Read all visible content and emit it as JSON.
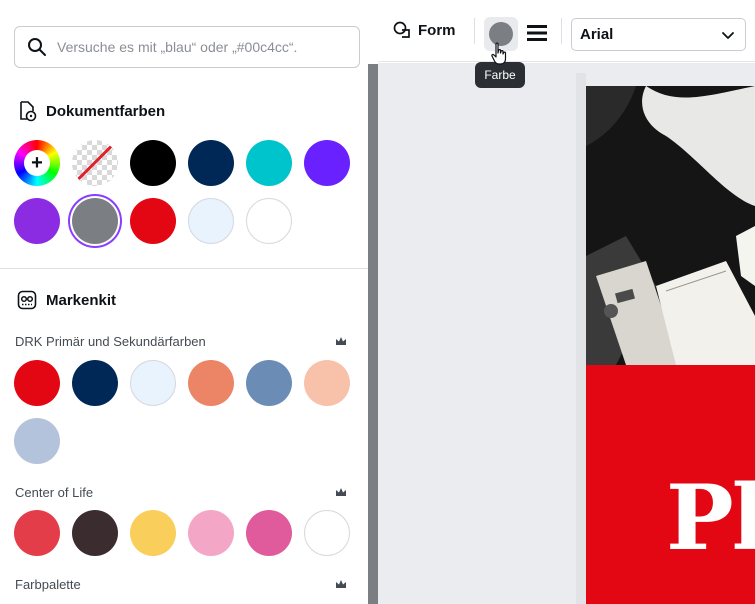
{
  "search": {
    "placeholder": "Versuche es mit „blau“ oder „#00c4cc“."
  },
  "document_colors": {
    "title": "Dokumentfarben",
    "swatches": [
      {
        "kind": "add",
        "color": "rainbow"
      },
      {
        "kind": "transparent",
        "color": "transparent"
      },
      {
        "kind": "color",
        "color": "#000000"
      },
      {
        "kind": "color",
        "color": "#002856"
      },
      {
        "kind": "color",
        "color": "#00c4cc"
      },
      {
        "kind": "color",
        "color": "#6a21ff"
      },
      {
        "kind": "color",
        "color": "#8b2be2"
      },
      {
        "kind": "color",
        "color": "#7b7f84",
        "selected": true
      },
      {
        "kind": "color",
        "color": "#e30613"
      },
      {
        "kind": "color",
        "color": "#e9f3fd"
      },
      {
        "kind": "color",
        "color": "#ffffff"
      }
    ]
  },
  "brand_kit": {
    "title": "Markenkit",
    "palettes": [
      {
        "name": "DRK Primär und Sekundärfarben",
        "colors": [
          "#e30613",
          "#002856",
          "#e9f3fd",
          "#ec8466",
          "#6b8db5",
          "#f8c1a9",
          "#b3c3db"
        ]
      },
      {
        "name": "Center of Life",
        "colors": [
          "#e33d4a",
          "#3a2c2f",
          "#f9ce5b",
          "#f4a6c6",
          "#e05b9b",
          "#ffffff"
        ]
      },
      {
        "name": "Farbpalette",
        "colors": []
      }
    ]
  },
  "toolbar": {
    "shape_label": "Form",
    "color_tooltip": "Farbe",
    "current_color": "#7b7f84",
    "font_name": "Arial"
  },
  "canvas": {
    "accent_color": "#e30613",
    "headline_visible_text": "Pl"
  }
}
